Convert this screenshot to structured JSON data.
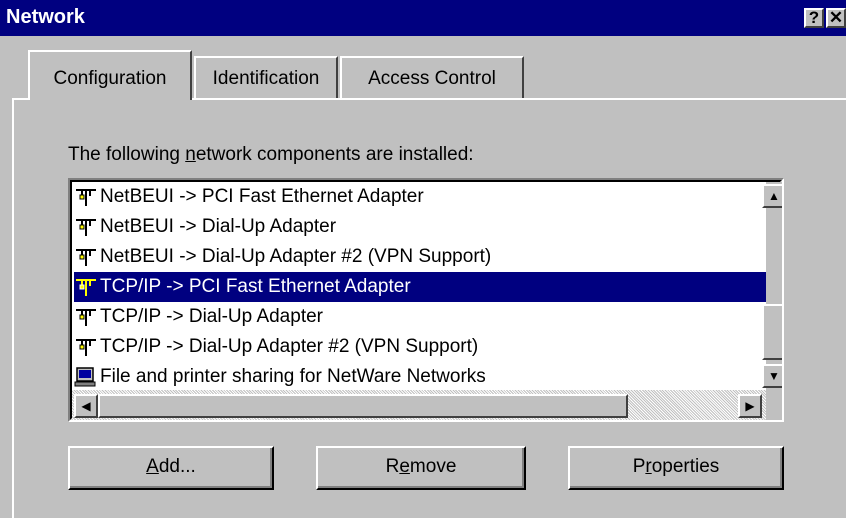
{
  "window": {
    "title": "Network",
    "help_label": "?",
    "close_label": "✕"
  },
  "tabs": [
    {
      "label": "Configuration",
      "active": true
    },
    {
      "label": "Identification",
      "active": false
    },
    {
      "label": "Access Control",
      "active": false
    }
  ],
  "components": {
    "label_prefix": "The following ",
    "label_accel": "n",
    "label_suffix": "etwork components are installed:",
    "items": [
      {
        "label": "NetBEUI -> PCI Fast Ethernet Adapter",
        "icon": "protocol-icon",
        "selected": false
      },
      {
        "label": "NetBEUI -> Dial-Up Adapter",
        "icon": "protocol-icon",
        "selected": false
      },
      {
        "label": "NetBEUI -> Dial-Up Adapter #2 (VPN Support)",
        "icon": "protocol-icon",
        "selected": false
      },
      {
        "label": "TCP/IP -> PCI Fast Ethernet Adapter",
        "icon": "protocol-icon",
        "selected": true
      },
      {
        "label": "TCP/IP -> Dial-Up Adapter",
        "icon": "protocol-icon",
        "selected": false
      },
      {
        "label": "TCP/IP -> Dial-Up Adapter #2 (VPN Support)",
        "icon": "protocol-icon",
        "selected": false
      },
      {
        "label": "File and printer sharing for NetWare Networks",
        "icon": "service-icon",
        "selected": false
      }
    ]
  },
  "buttons": {
    "add": {
      "accel": "A",
      "rest": "dd..."
    },
    "remove": {
      "pre": "R",
      "accel": "e",
      "rest": "move"
    },
    "properties": {
      "pre": "P",
      "accel": "r",
      "rest": "operties"
    }
  },
  "colors": {
    "titlebar": "#000080",
    "face": "#c0c0c0",
    "selection": "#000080"
  }
}
